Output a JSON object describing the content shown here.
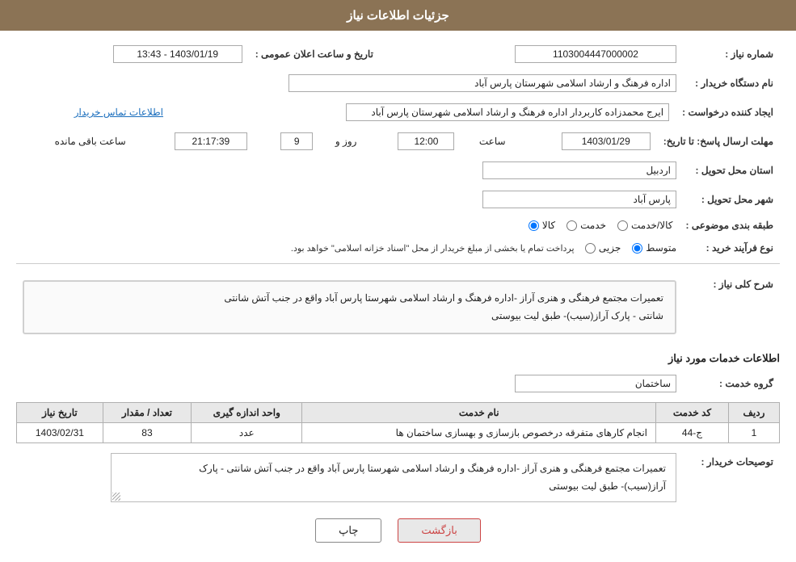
{
  "header": {
    "title": "جزئیات اطلاعات نیاز"
  },
  "fields": {
    "shomareNiaz_label": "شماره نیاز :",
    "shomareNiaz_value": "1103004447000002",
    "namDastgah_label": "نام دستگاه خریدار :",
    "namDastgah_value": "اداره فرهنگ و ارشاد اسلامی شهرستان پارس آباد",
    "ijadKonande_label": "ایجاد کننده درخواست :",
    "ijadKonande_value": "ایرج محمدزاده کاربردار اداره فرهنگ و ارشاد اسلامی شهرستان پارس آباد",
    "ettelaatLink": "اطلاعات تماس خریدار",
    "tarikh_label": "تاریخ و ساعت اعلان عمومی :",
    "tarikh_value": "1403/01/19 - 13:43",
    "mohlat_label": "مهلت ارسال پاسخ: تا تاریخ:",
    "mohlat_date": "1403/01/29",
    "mohlat_saat_label": "ساعت",
    "mohlat_saat": "12:00",
    "mohlat_rooz_label": "روز و",
    "mohlat_rooz": "9",
    "mohlat_baqi_label": "ساعت باقی مانده",
    "mohlat_baqi": "21:17:39",
    "ostan_label": "استان محل تحویل :",
    "ostan_value": "اردبیل",
    "shahr_label": "شهر محل تحویل :",
    "shahr_value": "پارس آباد",
    "tabaqe_label": "طبقه بندی موضوعی :",
    "tabaqe_options": [
      "کالا",
      "خدمت",
      "کالا/خدمت"
    ],
    "tabaqe_selected": "کالا",
    "noeFarayand_label": "نوع فرآیند خرید :",
    "noeFarayand_options": [
      "جزیی",
      "متوسط"
    ],
    "noeFarayand_selected": "متوسط",
    "noeFarayand_note": "پرداخت تمام یا بخشی از مبلغ خریدار از محل \"اسناد خزانه اسلامی\" خواهد بود.",
    "sharh_label": "شرح کلی نیاز :",
    "sharh_text_line1": "تعمیرات مجتمع فرهنگی و هنری آراز -اداره فرهنگ و ارشاد اسلامی شهرستا پارس آباد واقع در جنب آتش شانتی",
    "sharh_text_line2": "شانتی - پارک آراز(سیب)- طبق لیت بیوستی",
    "khadamat_label": "اطلاعات خدمات مورد نیاز",
    "gerohe_khadamat_label": "گروه خدمت :",
    "gerohe_khadamat_value": "ساختمان",
    "table": {
      "headers": [
        "ردیف",
        "کد خدمت",
        "نام خدمت",
        "واحد اندازه گیری",
        "تعداد / مقدار",
        "تاریخ نیاز"
      ],
      "rows": [
        {
          "radif": "1",
          "kodKhadamat": "ج-44",
          "namKhadamat": "انجام کارهای متفرقه درخصوص بازسازی و بهسازی ساختمان ها",
          "vahed": "عدد",
          "tedad": "83",
          "tarikh": "1403/02/31"
        }
      ]
    },
    "buyer_desc_label": "توصیحات خریدار :",
    "buyer_desc_text_line1": "تعمیرات مجتمع فرهنگی و هنری آراز -اداره فرهنگ و ارشاد اسلامی شهرستا پارس آباد واقع در جنب آتش شانتی - پارک",
    "buyer_desc_text_line2": "آراز(سیب)- طبق لیت بیوستی",
    "btn_print": "چاپ",
    "btn_back": "بازگشت"
  }
}
